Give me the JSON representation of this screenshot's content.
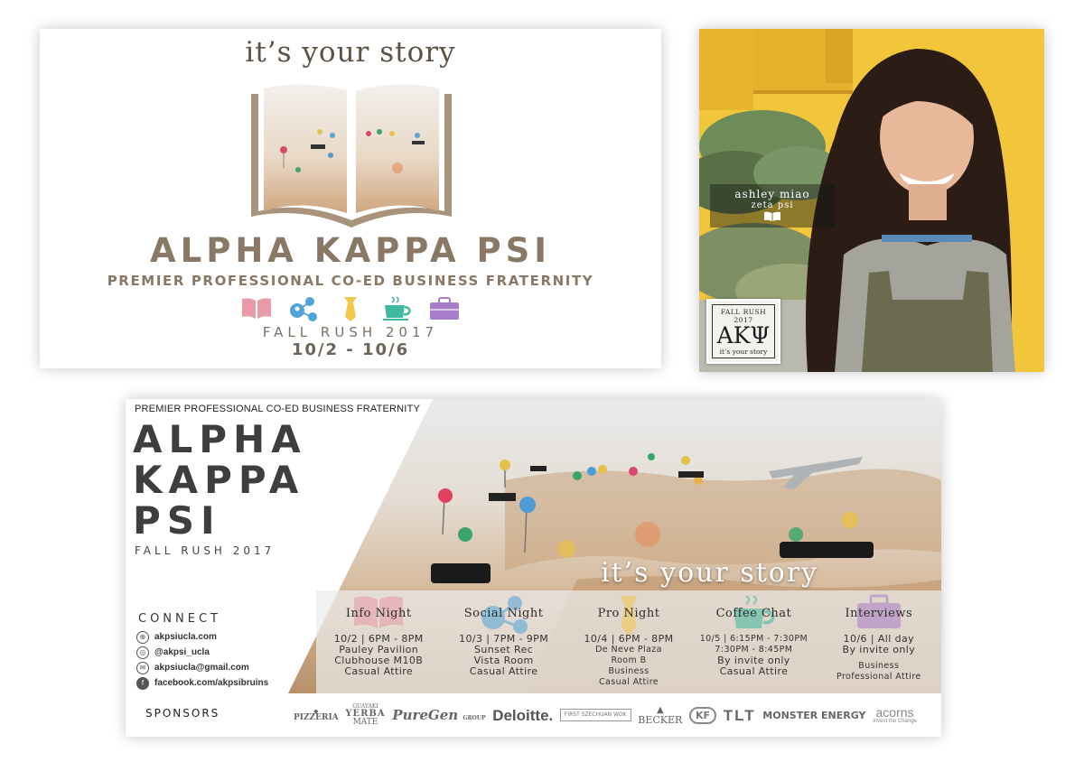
{
  "banner": {
    "tagline": "it’s your story",
    "title": "ALPHA KAPPA PSI",
    "subtitle": "PREMIER PROFESSIONAL CO-ED BUSINESS FRATERNITY",
    "icons": [
      "book-icon",
      "network-icon",
      "tie-icon",
      "coffee-icon",
      "briefcase-icon"
    ],
    "rush": "FALL RUSH 2017",
    "dates": "10/2 - 10/6"
  },
  "profile": {
    "name": "ashley miao",
    "chapter": "zeta psi",
    "badge_rush": "FALL RUSH 2017",
    "badge_letters": "ΑΚΨ",
    "badge_tagline": "it’s your story"
  },
  "poster": {
    "topline": "PREMIER PROFESSIONAL CO-ED BUSINESS FRATERNITY",
    "title_lines": [
      "ALPHA",
      "KAPPA",
      "PSI"
    ],
    "rush": "FALL RUSH 2017",
    "tagline": "it’s your story",
    "connect_label": "CONNECT",
    "links": [
      {
        "icon": "globe-icon",
        "text": "akpsiucla.com"
      },
      {
        "icon": "instagram-icon",
        "text": "@akpsi_ucla"
      },
      {
        "icon": "email-icon",
        "text": "akpsiucla@gmail.com"
      },
      {
        "icon": "facebook-icon",
        "text": "facebook.com/akpsibruins"
      }
    ],
    "events": [
      {
        "title": "Info Night",
        "icon": "book-icon",
        "line1": "10/2 | 6PM - 8PM",
        "line2": "Pauley Pavilion",
        "line3": "Clubhouse M10B",
        "line4": "Casual Attire"
      },
      {
        "title": "Social Night",
        "icon": "network-icon",
        "line1": "10/3 | 7PM - 9PM",
        "line2": "Sunset Rec",
        "line3": "Vista Room",
        "line4": "Casual Attire"
      },
      {
        "title": "Pro Night",
        "icon": "tie-icon",
        "line1": "10/4 | 6PM - 8PM",
        "line2": "De Neve Plaza",
        "line3": "Room B",
        "line4": "Business",
        "line5": "Casual Attire"
      },
      {
        "title": "Coffee Chat",
        "icon": "coffee-icon",
        "line1": "10/5 | 6:15PM - 7:30PM",
        "line2": "7:30PM - 8:45PM",
        "line3": "By invite only",
        "line4": "Casual Attire"
      },
      {
        "title": "Interviews",
        "icon": "briefcase-icon",
        "line1": "10/6 | All day",
        "line2": "By invite only",
        "line3": "Business",
        "line4": "Professional Attire"
      }
    ],
    "sponsors_label": "SPONSORS",
    "sponsors": {
      "pizzeria": "PIZZERIA",
      "yerba_top": "GUAYAKI",
      "yerba_name": "YERBA",
      "yerba_bottom": "MATE",
      "puregen": "PureGen",
      "puregen_sub": "GROUP",
      "deloitte": "Deloitte.",
      "first_sz": "FIRST SZECHUAN WOK",
      "becker": "BECKER",
      "kf": "KF",
      "tlt": "TLT",
      "monster": "MONSTER ENERGY",
      "acorns": "acorns",
      "acorns_sub": "Invest the Change"
    }
  },
  "colors": {
    "book": "#e89aa6",
    "network": "#4fa3d9",
    "tie": "#f2c84b",
    "coffee": "#3fb8a0",
    "briefcase": "#a77cc8",
    "brown_text": "#8a7866"
  }
}
